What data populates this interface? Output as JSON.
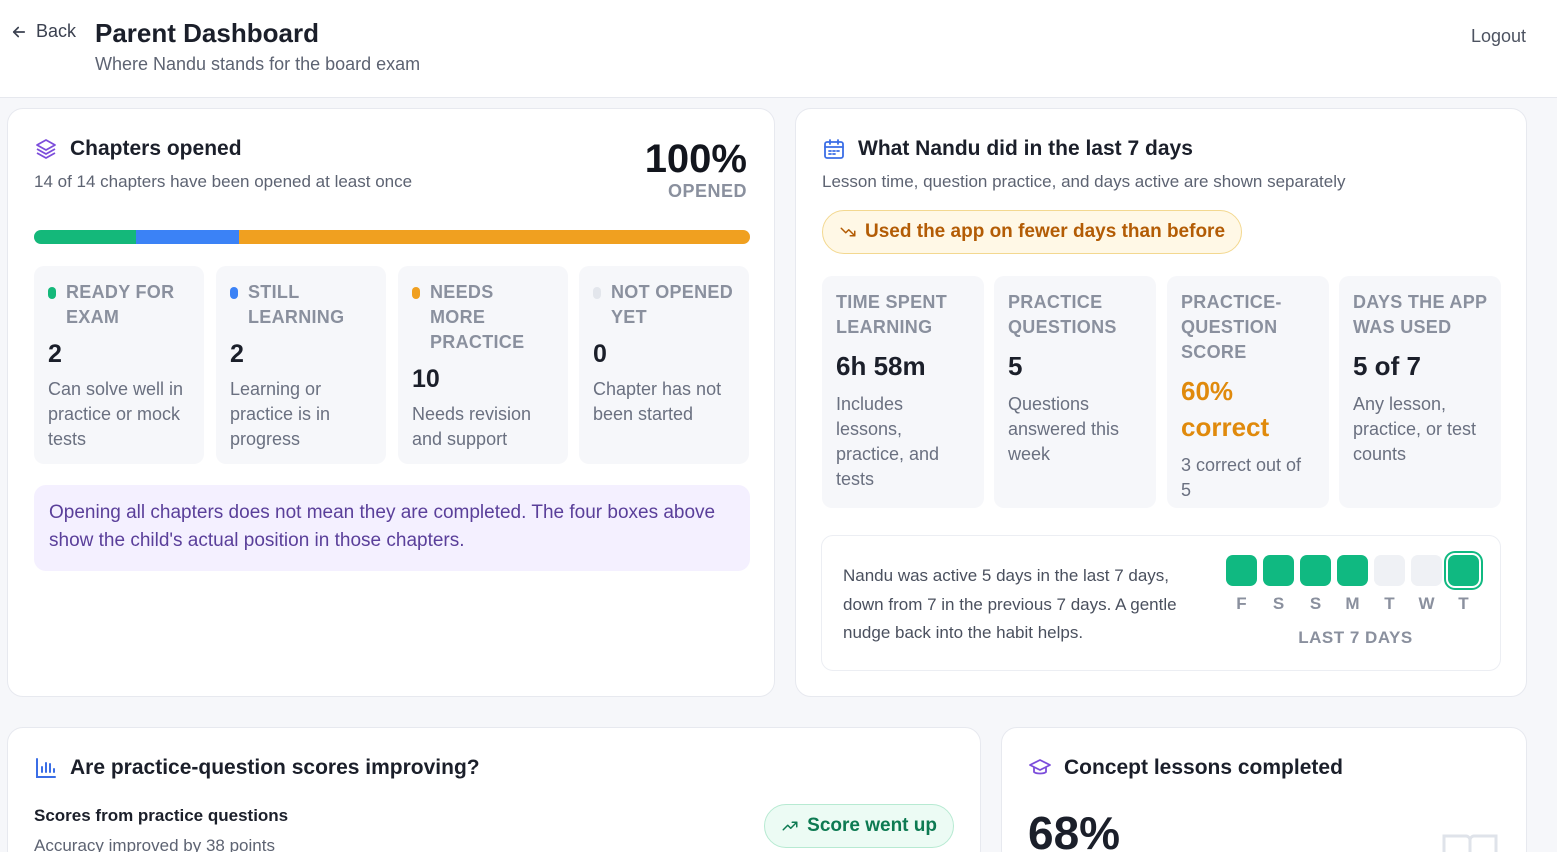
{
  "header": {
    "back_label": "Back",
    "title": "Parent Dashboard",
    "subtitle": "Where Nandu stands for the board exam",
    "logout_label": "Logout"
  },
  "chapters": {
    "title": "Chapters opened",
    "subtitle": "14 of 14 chapters have been opened at least once",
    "percent": "100%",
    "percent_label": "OPENED",
    "progress": {
      "segments": [
        {
          "name": "ready",
          "fraction": 0.1429,
          "color": "#14b87a"
        },
        {
          "name": "learning",
          "fraction": 0.1429,
          "color": "#3b82f6"
        },
        {
          "name": "practice",
          "fraction": 0.7142,
          "color": "#f0a020"
        }
      ]
    },
    "stats": [
      {
        "label": "READY FOR EXAM",
        "value": "2",
        "desc": "Can solve well in practice or mock tests",
        "color": "#14b87a"
      },
      {
        "label": "STILL LEARNING",
        "value": "2",
        "desc": "Learning or practice is in progress",
        "color": "#3b82f6"
      },
      {
        "label": "NEEDS MORE PRACTICE",
        "value": "10",
        "desc": "Needs revision and support",
        "color": "#f0a020"
      },
      {
        "label": "NOT OPENED YET",
        "value": "0",
        "desc": "Chapter has not been started",
        "color": "#e3e6ec"
      }
    ],
    "note": "Opening all chapters does not mean they are completed. The four boxes above show the child's actual position in those chapters."
  },
  "week": {
    "title": "What Nandu did in the last 7 days",
    "subtitle": "Lesson time, question practice, and days active are shown separately",
    "alert": "Used the app on fewer days than before",
    "stats": [
      {
        "label": "TIME SPENT LEARNING",
        "value": "6h 58m",
        "desc": "Includes lessons, practice, and tests"
      },
      {
        "label": "PRACTICE QUESTIONS",
        "value": "5",
        "desc": "Questions answered this week"
      },
      {
        "label": "PRACTICE-QUESTION SCORE",
        "value": "60% correct",
        "desc": "3 correct out of 5"
      },
      {
        "label": "DAYS THE APP WAS USED",
        "value": "5 of 7",
        "desc": "Any lesson, practice, or test counts"
      }
    ],
    "streak_text": "Nandu was active 5 days in the last 7 days, down from 7 in the previous 7 days. A gentle nudge back into the habit helps.",
    "days": [
      {
        "d": "F",
        "active": true
      },
      {
        "d": "S",
        "active": true
      },
      {
        "d": "S",
        "active": true
      },
      {
        "d": "M",
        "active": true
      },
      {
        "d": "T",
        "active": false
      },
      {
        "d": "W",
        "active": false
      },
      {
        "d": "T",
        "active": true,
        "today": true
      }
    ],
    "days_label": "LAST 7 DAYS"
  },
  "scores": {
    "title": "Are practice-question scores improving?",
    "section_title": "Scores from practice questions",
    "section_sub": "Accuracy improved by 38 points",
    "trend_label": "Score went up"
  },
  "concepts": {
    "title": "Concept lessons completed",
    "percent": "68%"
  }
}
